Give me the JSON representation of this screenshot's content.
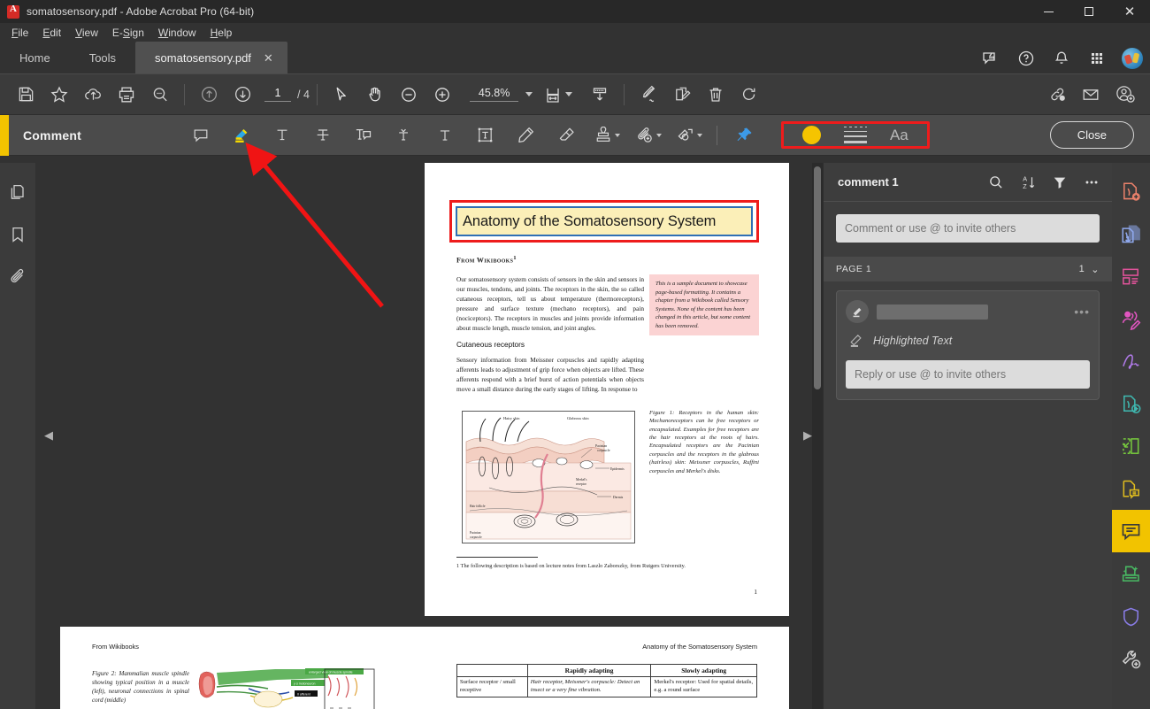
{
  "window": {
    "title": "somatosensory.pdf - Adobe Acrobat Pro (64-bit)",
    "minimize": "─",
    "maximize": "□",
    "close": "✕"
  },
  "menubar": {
    "items": [
      "File",
      "Edit",
      "View",
      "E-Sign",
      "Window",
      "Help"
    ]
  },
  "tabs": {
    "home": "Home",
    "tools": "Tools",
    "document": "somatosensory.pdf",
    "close_glyph": "✕"
  },
  "toolbar": {
    "page_current": "1",
    "page_total": "/ 4",
    "zoom_value": "45.8%",
    "icons": [
      "save-icon",
      "star-icon",
      "upload-cloud-icon",
      "print-icon",
      "search-icon",
      "previous-page-icon",
      "next-page-icon",
      "select-cursor-icon",
      "hand-tool-icon",
      "zoom-out-icon",
      "zoom-in-icon",
      "fit-page-icon",
      "scroll-mode-icon",
      "sign-icon",
      "request-signature-icon",
      "delete-icon",
      "rotate-icon",
      "share-link-icon",
      "email-icon",
      "add-person-icon"
    ]
  },
  "comment_toolbar": {
    "title": "Comment",
    "tools": [
      {
        "name": "sticky-note-icon",
        "label": "Add sticky note"
      },
      {
        "name": "highlight-text-icon",
        "label": "Highlight text"
      },
      {
        "name": "underline-text-icon",
        "label": "Underline text"
      },
      {
        "name": "strikethrough-text-icon",
        "label": "Strikethrough text"
      },
      {
        "name": "add-note-to-replace-text-icon",
        "label": "Add note to replace text"
      },
      {
        "name": "insert-text-icon",
        "label": "Insert text at cursor"
      },
      {
        "name": "add-text-comment-icon",
        "label": "Add text comment"
      },
      {
        "name": "text-box-icon",
        "label": "Add text box"
      },
      {
        "name": "draw-free-form-icon",
        "label": "Draw free form"
      },
      {
        "name": "erase-icon",
        "label": "Erase"
      },
      {
        "name": "stamp-icon",
        "label": "Add stamp"
      },
      {
        "name": "attach-file-icon",
        "label": "Attach file"
      },
      {
        "name": "drawing-tools-icon",
        "label": "Drawing tools"
      },
      {
        "name": "pin-toolbar-icon",
        "label": "Keep tool selected"
      }
    ],
    "properties": {
      "color_swatch": "#f5c400",
      "color_name": "color-swatch-yellow",
      "thickness_name": "line-thickness-icon",
      "text_props_label": "Aa"
    },
    "close_label": "Close"
  },
  "left_rail": {
    "items": [
      {
        "name": "page-thumbnails-icon"
      },
      {
        "name": "bookmarks-icon"
      },
      {
        "name": "attachments-icon"
      }
    ]
  },
  "right_rail": {
    "items": [
      {
        "name": "create-pdf-icon",
        "color": "#e8806a"
      },
      {
        "name": "export-pdf-icon",
        "color": "#8fa8ec"
      },
      {
        "name": "organize-pages-icon",
        "color": "#e0539a"
      },
      {
        "name": "redact-icon",
        "color": "#e155c0"
      },
      {
        "name": "fill-and-sign-icon",
        "color": "#b07ae8"
      },
      {
        "name": "combine-files-icon",
        "color": "#3fb8b0"
      },
      {
        "name": "crop-pages-icon",
        "color": "#76c83d"
      },
      {
        "name": "add-comment-page-icon",
        "color": "#e0bc1e"
      },
      {
        "name": "comment-panel-icon",
        "color": "#3b3b3b",
        "active": true
      },
      {
        "name": "scan-and-ocr-icon",
        "color": "#49b863"
      },
      {
        "name": "protect-icon",
        "color": "#8a7de8"
      },
      {
        "name": "more-tools-icon",
        "color": "#cfcfcf"
      }
    ]
  },
  "comment_panel": {
    "title": "comment 1",
    "header_icons": [
      "search-comments-icon",
      "sort-comments-icon",
      "filter-comments-icon",
      "more-options-icon"
    ],
    "new_comment_placeholder": "Comment or use @ to invite others",
    "page_group_label": "PAGE 1",
    "page_group_count": "1",
    "page_group_chevron": "⌄",
    "card": {
      "author_redacted": true,
      "more_glyph": "•••",
      "annotation_icon": "highlight-marker-icon",
      "body_text": "Highlighted Text",
      "reply_placeholder": "Reply or use @ to invite others"
    }
  },
  "viewer": {
    "scroll_left_glyph": "◀",
    "scroll_right_glyph": "▶"
  },
  "document": {
    "page1": {
      "title": "Anatomy of the Somatosensory System",
      "title_highlight_color": "#fbefb8",
      "title_selection_border": "#2f6fb5",
      "byline": "From Wikibooks",
      "byline_footnote_marker": "1",
      "paragraph1": "Our somatosensory system consists of sensors in the skin and sensors in our muscles, tendons, and joints. The receptors in the skin, the so called cutaneous receptors, tell us about temperature (thermoreceptors), pressure and surface texture (mechano receptors), and pain (nociceptors). The receptors in muscles and joints provide information about muscle length, muscle tension, and joint angles.",
      "subheading": "Cutaneous receptors",
      "paragraph2": "Sensory information from Meissner corpuscles and rapidly adapting afferents leads to adjustment of grip force when objects are lifted. These afferents respond with a brief burst of action potentials when objects move a small distance during the early stages of lifting. In response to",
      "pink_note": "This is a sample document to showcase page-based formatting. It contains a chapter from a Wikibook called Sensory Systems. None of the content has been changed in this article, but some content has been removed.",
      "figure_caption": "Figure 1: Receptors in the human skin: Mechanoreceptors can be free receptors or encapsulated. Examples for free receptors are the hair receptors at the roots of hairs. Encapsulated receptors are the Pacinian corpuscles and the receptors in the glabrous (hairless) skin: Meissner corpuscles, Ruffini corpuscles and Merkel's disks.",
      "figure_labels": {
        "hairy_skin": "Hairy skin",
        "glabrous_skin": "Glabrous skin",
        "epidermis": "Epidermis",
        "dermis": "Dermis",
        "pacinian": "Pacinian corpuscle",
        "ruffini": "Ruffini's ending",
        "meissner": "Meissner corpuscle",
        "merkel": "Merkel's receptor"
      },
      "footnote": "1 The following description is based on lecture notes from Laszlo Zaborszky, from Rutgers University.",
      "page_number": "1"
    },
    "page2_left": {
      "header": "From Wikibooks",
      "figure_caption": "Figure 2: Mammalian muscle spindle showing typical position in a muscle (left), neuronal connections in spinal cord (middle)",
      "image_labels": [
        "enlarged view of muscle spindle",
        "γ α motoneuron",
        "II afferent"
      ]
    },
    "page2_right": {
      "header": "Anatomy of the Somatosensory System",
      "table": {
        "columns": [
          "",
          "Rapidly adapting",
          "Slowly adapting"
        ],
        "rows": [
          [
            "Surface receptor / small receptive",
            "Hair receptor, Meissner's corpuscle: Detect an insect or a very fine vibration.",
            "Merkel's receptor: Used for spatial details, e.g. a round surface"
          ]
        ]
      }
    }
  }
}
